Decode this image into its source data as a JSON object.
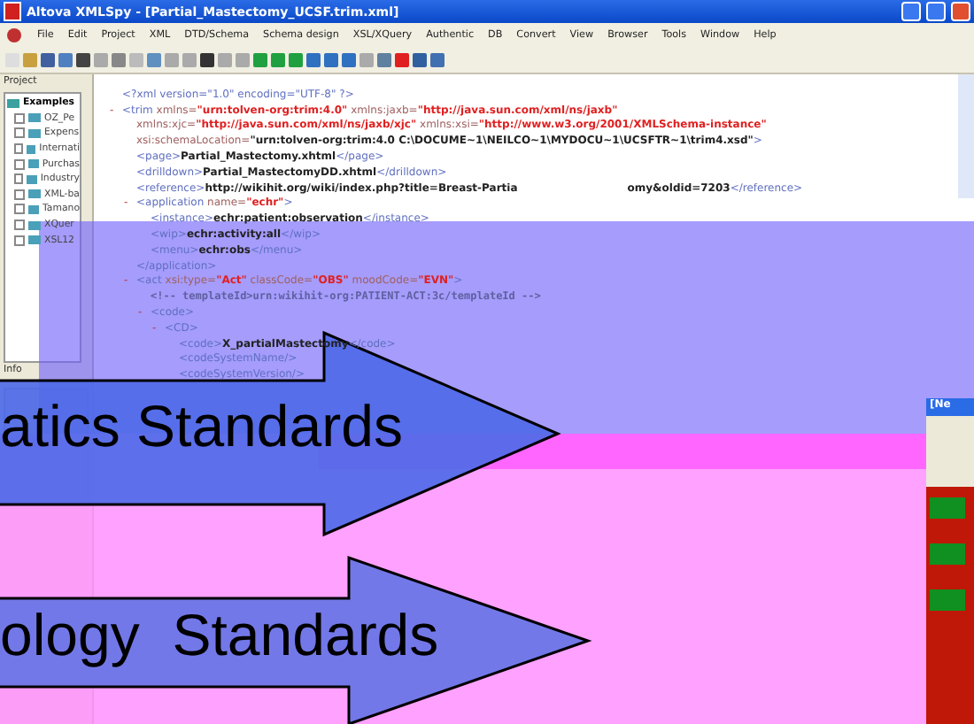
{
  "window": {
    "title": "Altova XMLSpy - [Partial_Mastectomy_UCSF.trim.xml]"
  },
  "menu": [
    "File",
    "Edit",
    "Project",
    "XML",
    "DTD/Schema",
    "Schema design",
    "XSL/XQuery",
    "Authentic",
    "DB",
    "Convert",
    "View",
    "Browser",
    "Tools",
    "Window",
    "Help"
  ],
  "project_panel": {
    "title": "Project",
    "root": {
      "label": "Examples",
      "children": [
        {
          "label": "OZ_Pe"
        },
        {
          "label": "Expens"
        },
        {
          "label": "Internati"
        },
        {
          "label": "Purchas"
        },
        {
          "label": "Industry"
        },
        {
          "label": "XML-ba"
        },
        {
          "label": "Tamano"
        },
        {
          "label": "XQuer"
        },
        {
          "label": "XSL12"
        }
      ]
    }
  },
  "info_panel": {
    "title": "Info"
  },
  "editor": {
    "lines": [
      {
        "parts": [
          {
            "kind": "markup",
            "text": "<?xml version=\"1.0\" encoding=\"UTF-8\" ?>"
          }
        ]
      },
      {
        "toggle": "-",
        "parts": [
          {
            "kind": "markup",
            "text": "<trim "
          },
          {
            "kind": "attr",
            "text": "xmlns="
          },
          {
            "kind": "value",
            "text": "\"urn:tolven-org:trim:4.0\""
          },
          {
            "kind": "attr",
            "text": " xmlns:jaxb="
          },
          {
            "kind": "value",
            "text": "\"http://java.sun.com/xml/ns/jaxb\""
          }
        ],
        "children": [
          {
            "parts": [
              {
                "kind": "attr",
                "text": "xmlns:xjc="
              },
              {
                "kind": "value",
                "text": "\"http://java.sun.com/xml/ns/jaxb/xjc\""
              },
              {
                "kind": "attr",
                "text": " xmlns:xsi="
              },
              {
                "kind": "value",
                "text": "\"http://www.w3.org/2001/XMLSchema-instance\""
              }
            ]
          },
          {
            "parts": [
              {
                "kind": "attr",
                "text": "xsi:schemaLocation="
              },
              {
                "kind": "content",
                "text": "\"urn:tolven-org:trim:4.0 C:\\DOCUME~1\\NEILCO~1\\MYDOCU~1\\UCSFTR~1\\trim4.xsd\""
              },
              {
                "kind": "markup",
                "text": ">"
              }
            ]
          },
          {
            "parts": [
              {
                "kind": "markup",
                "text": "<page>"
              },
              {
                "kind": "content",
                "text": "Partial_Mastectomy.xhtml"
              },
              {
                "kind": "markup",
                "text": "</page>"
              }
            ]
          },
          {
            "parts": [
              {
                "kind": "markup",
                "text": "<drilldown>"
              },
              {
                "kind": "content",
                "text": "Partial_MastectomyDD.xhtml"
              },
              {
                "kind": "markup",
                "text": "</drilldown>"
              }
            ]
          },
          {
            "parts": [
              {
                "kind": "markup",
                "text": "<reference>"
              },
              {
                "kind": "content",
                "text": "http://wikihit.org/wiki/index.php?title=Breast-Partia"
              },
              {
                "kind": "gap"
              },
              {
                "kind": "content",
                "text": "omy&oldid=7203"
              },
              {
                "kind": "markup",
                "text": "</reference>"
              }
            ]
          },
          {
            "toggle": "-",
            "parts": [
              {
                "kind": "markup",
                "text": "<application "
              },
              {
                "kind": "attr",
                "text": "name="
              },
              {
                "kind": "value",
                "text": "\"echr\""
              },
              {
                "kind": "markup",
                "text": ">"
              }
            ],
            "children": [
              {
                "parts": [
                  {
                    "kind": "markup",
                    "text": "<instance>"
                  },
                  {
                    "kind": "content",
                    "text": "echr:patient:observation"
                  },
                  {
                    "kind": "markup",
                    "text": "</instance>"
                  }
                ]
              },
              {
                "parts": [
                  {
                    "kind": "markup",
                    "text": "<wip>"
                  },
                  {
                    "kind": "content",
                    "text": "echr:activity:all"
                  },
                  {
                    "kind": "markup",
                    "text": "</wip>"
                  }
                ]
              },
              {
                "parts": [
                  {
                    "kind": "markup",
                    "text": "<menu>"
                  },
                  {
                    "kind": "content",
                    "text": "echr:obs"
                  },
                  {
                    "kind": "markup",
                    "text": "</menu>"
                  }
                ]
              }
            ]
          },
          {
            "parts": [
              {
                "kind": "markup",
                "text": "</application>"
              }
            ]
          },
          {
            "toggle": "-",
            "parts": [
              {
                "kind": "markup",
                "text": "<act "
              },
              {
                "kind": "attr",
                "text": "xsi:type="
              },
              {
                "kind": "value",
                "text": "\"Act\""
              },
              {
                "kind": "attr",
                "text": " classCode="
              },
              {
                "kind": "value",
                "text": "\"OBS\""
              },
              {
                "kind": "attr",
                "text": " moodCode="
              },
              {
                "kind": "value",
                "text": "\"EVN\""
              },
              {
                "kind": "markup",
                "text": ">"
              }
            ],
            "children": [
              {
                "parts": [
                  {
                    "kind": "comment",
                    "text": "<!-- templateId>urn:wikihit-org:PATIENT-ACT:3c/templateId -->"
                  }
                ]
              },
              {
                "toggle": "-",
                "parts": [
                  {
                    "kind": "markup",
                    "text": "<code>"
                  }
                ],
                "children": [
                  {
                    "toggle": "-",
                    "parts": [
                      {
                        "kind": "markup",
                        "text": "<CD>"
                      }
                    ],
                    "children": [
                      {
                        "parts": [
                          {
                            "kind": "markup",
                            "text": "<code>"
                          },
                          {
                            "kind": "content",
                            "text": "X_partialMastectomy"
                          },
                          {
                            "kind": "markup",
                            "text": "</code>"
                          }
                        ]
                      },
                      {
                        "parts": [
                          {
                            "kind": "markup",
                            "text": "<codeSystemName/>"
                          }
                        ]
                      },
                      {
                        "parts": [
                          {
                            "kind": "markup",
                            "text": "<codeSystemVersion/>"
                          }
                        ]
                      }
                    ]
                  }
                ]
              }
            ]
          }
        ]
      }
    ]
  },
  "arrows": [
    {
      "label": "atics Standards"
    },
    {
      "label": "ology  Standards"
    }
  ],
  "browser_window": {
    "title": "[Ne"
  }
}
